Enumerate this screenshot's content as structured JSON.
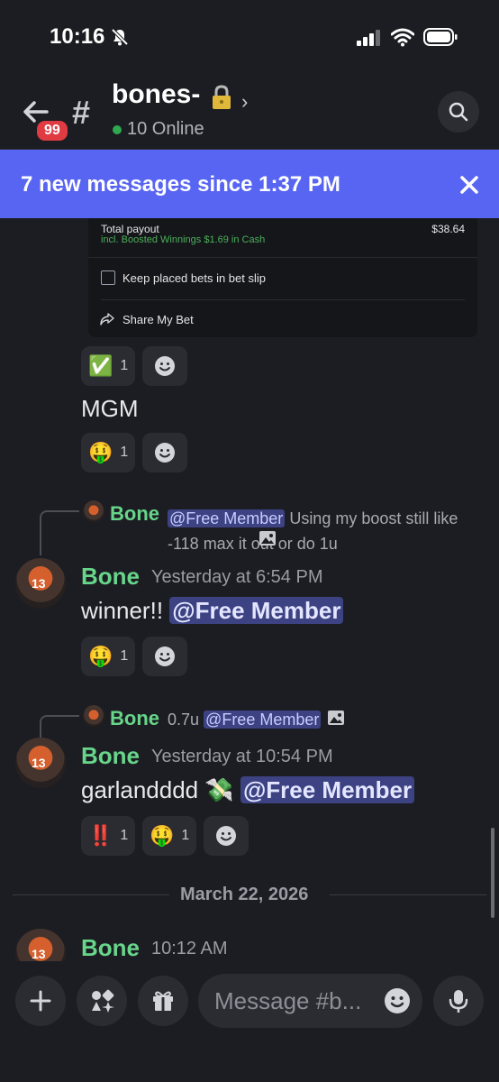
{
  "status_bar": {
    "time": "10:16"
  },
  "header": {
    "channel_name": "bones-",
    "badge": "99",
    "online_text": "10 Online",
    "back_icon": "arrow-left-icon",
    "search_icon": "search-icon"
  },
  "banner": {
    "text": "7 new messages since 1:37 PM"
  },
  "bet_card": {
    "total_payout_label": "Total payout",
    "total_payout_amount": "$38.64",
    "boosted_note": "incl. Boosted Winnings $1.69 in Cash",
    "keep_label": "Keep placed bets in bet slip",
    "share_label": "Share My Bet"
  },
  "messages": [
    {
      "reactions": [
        {
          "emoji": "✅",
          "count": "1"
        }
      ],
      "text": "MGM",
      "reactions2": [
        {
          "emoji": "🤑",
          "count": "1"
        }
      ]
    },
    {
      "reply_author": "Bone",
      "reply_mention": "@Free Member",
      "reply_text": " Using my boost still like -118 max it out or do 1u",
      "author": "Bone",
      "timestamp": "Yesterday at 6:54 PM",
      "text": "winner!! ",
      "mention": "@Free Member",
      "reactions": [
        {
          "emoji": "🤑",
          "count": "1"
        }
      ]
    },
    {
      "reply_author": "Bone",
      "reply_prefix": "0.7u ",
      "reply_mention": "@Free Member",
      "author": "Bone",
      "timestamp": "Yesterday at 10:54 PM",
      "text": "garlandddd 💸 ",
      "mention": "@Free Member",
      "reactions": [
        {
          "emoji": "‼️",
          "count": "1"
        },
        {
          "emoji": "🤑",
          "count": "1"
        }
      ]
    }
  ],
  "date_divider": "March 22, 2026",
  "last_message": {
    "author": "Bone",
    "timestamp": "10:12 AM"
  },
  "composer": {
    "placeholder": "Message #b..."
  },
  "colors": {
    "accent": "#5865f2",
    "author": "#67d58a",
    "badge": "#e03b43",
    "background": "#1c1d22"
  }
}
